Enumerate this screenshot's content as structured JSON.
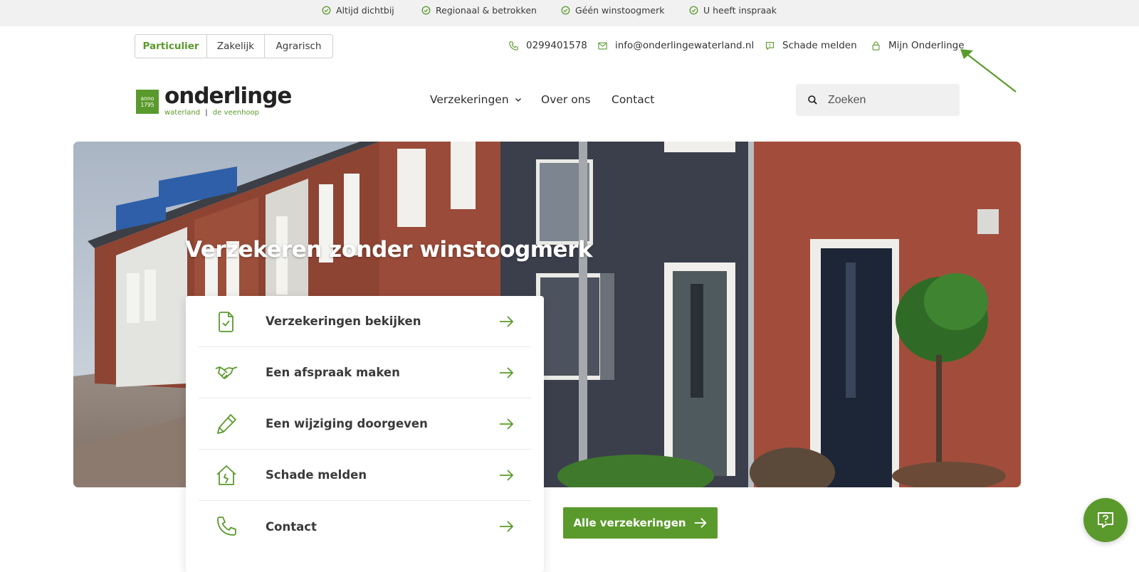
{
  "usp": [
    {
      "label": "Altijd dichtbij",
      "icon": "check-circle-icon"
    },
    {
      "label": "Regionaal & betrokken",
      "icon": "check-circle-icon"
    },
    {
      "label": "Géén winstoogmerk",
      "icon": "check-circle-icon"
    },
    {
      "label": "U heeft inspraak",
      "icon": "check-circle-icon"
    }
  ],
  "segments": [
    {
      "label": "Particulier",
      "active": true
    },
    {
      "label": "Zakelijk",
      "active": false
    },
    {
      "label": "Agrarisch",
      "active": false
    }
  ],
  "service": {
    "phone": "0299401578",
    "email": "info@onderlingewaterland.nl",
    "damage": "Schade melden",
    "account": "Mijn Onderlinge"
  },
  "logo": {
    "badge_line1": "anno",
    "badge_line2": "1795",
    "wordmark": "onderlinge",
    "sub_left": "waterland",
    "sub_divider": "|",
    "sub_right": "de veenhoop"
  },
  "nav": {
    "insurance": "Verzekeringen",
    "about": "Over ons",
    "contact": "Contact"
  },
  "search": {
    "placeholder": "Zoeken"
  },
  "hero": {
    "title": "Verzekeren zonder winstoogmerk"
  },
  "actions": [
    {
      "label": "Verzekeringen bekijken",
      "icon": "document-check-icon"
    },
    {
      "label": "Een afspraak maken",
      "icon": "handshake-icon"
    },
    {
      "label": "Een wijziging doorgeven",
      "icon": "pencil-icon"
    },
    {
      "label": "Schade melden",
      "icon": "house-damage-icon"
    },
    {
      "label": "Contact",
      "icon": "phone-icon"
    }
  ],
  "cta": {
    "label": "Alle verzekeringen"
  },
  "colors": {
    "brand_green": "#5a9a2c",
    "topbar": "#f1f1f1",
    "text": "#2e2e2e"
  }
}
